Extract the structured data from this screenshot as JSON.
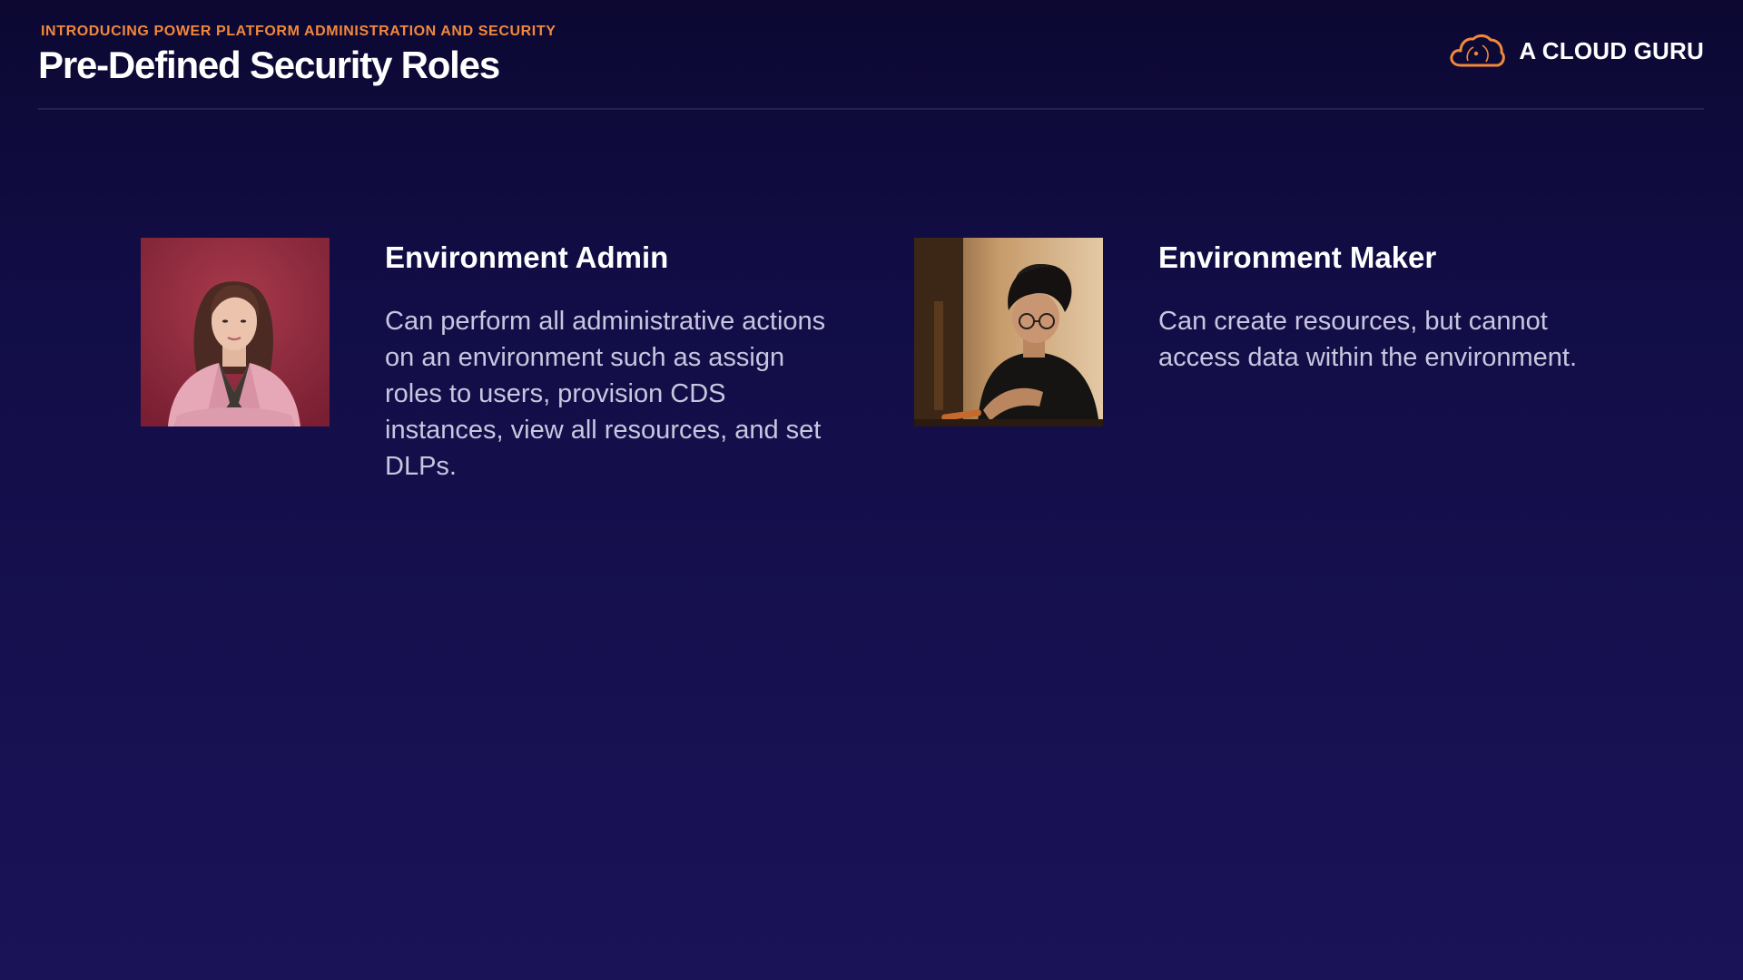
{
  "header": {
    "eyebrow": "INTRODUCING POWER PLATFORM ADMINISTRATION AND SECURITY",
    "title": "Pre-Defined Security Roles"
  },
  "brand": {
    "name": "A CLOUD GURU",
    "logo_icon": "cloud-logo-icon",
    "accent_color": "#f2883c"
  },
  "roles": [
    {
      "title": "Environment Admin",
      "description": "Can perform all administrative actions on an environment such as assign roles to users, provision CDS instances, view all resources, and set DLPs.",
      "photo_icon": "woman-portrait-photo"
    },
    {
      "title": "Environment Maker",
      "description": "Can create resources, but cannot access data within the environment.",
      "photo_icon": "man-working-photo"
    }
  ],
  "colors": {
    "background_top": "#0c0832",
    "background_bottom": "#1a1358",
    "body_text": "#c9c6df"
  }
}
